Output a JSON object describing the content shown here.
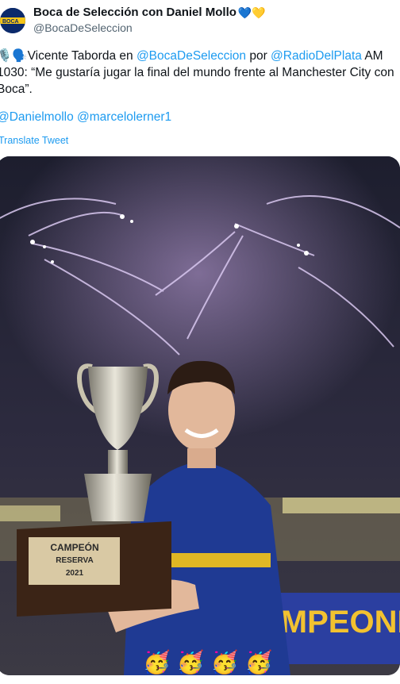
{
  "tweet": {
    "author_name": "Boca de Selección con Daniel Mollo",
    "author_emojis": "💙💛",
    "handle": "@BocaDeSeleccion",
    "text_part1": "Vicente Taborda en ",
    "mention1": "@BocaDeSeleccion",
    "text_por": " por ",
    "mention2": "@RadioDelPlata",
    "text_part2": " AM 1030: “Me gustaría jugar la final del mundo frente al Manchester City con Boca”.",
    "mention3": "@Danielmollo",
    "mention4": "@marcelolerner1",
    "translate_label": "Translate Tweet",
    "lead_emojis": "🎙️🗣️"
  },
  "media": {
    "trophy_line1": "CAMPEÓN",
    "trophy_line2": "RESERVA",
    "trophy_line3": "2021",
    "banner_text": "CAMPEONES",
    "overlay_emojis": [
      "🥳",
      "🥳",
      "🥳",
      "🥳"
    ]
  },
  "colors": {
    "link": "#1d9bf0",
    "boca_blue": "#1f3a93",
    "boca_gold": "#f5c518"
  }
}
